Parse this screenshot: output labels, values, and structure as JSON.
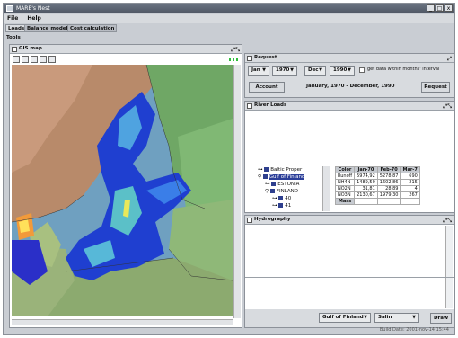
{
  "window": {
    "title": "MARE's Nest",
    "min": "_",
    "max": "□",
    "close": "x"
  },
  "menu": [
    "File",
    "Help"
  ],
  "tabs": [
    "Loads",
    "Balance model",
    "Cost calculation"
  ],
  "tools_label": "Tools",
  "gis": {
    "title": "GIS map"
  },
  "request": {
    "title": "Request",
    "from_month": "Jan",
    "from_year": "1970",
    "to_month": "Dec",
    "to_year": "1990",
    "checkbox_label": "get data within months' interval",
    "account_btn": "Account",
    "period": "January, 1970 - December, 1990",
    "request_btn": "Request"
  },
  "river_loads": {
    "title": "River Loads",
    "tree": [
      {
        "label": "Baltic Proper",
        "selected": false,
        "indent": 0
      },
      {
        "label": "Gulf of Finland",
        "selected": true,
        "indent": 0
      },
      {
        "label": "ESTONIA",
        "selected": false,
        "indent": 1
      },
      {
        "label": "FINLAND",
        "selected": false,
        "indent": 1
      },
      {
        "label": "40",
        "selected": false,
        "indent": 2
      },
      {
        "label": "41",
        "selected": false,
        "indent": 2
      }
    ],
    "columns": [
      "Color",
      "Jan-70",
      "Feb-70",
      "Mar-7"
    ],
    "rows": [
      [
        "Runoff",
        "5974,92",
        "5278,87",
        "690"
      ],
      [
        "NH4N",
        "1489,50",
        "1602,86",
        "215"
      ],
      [
        "NO2N",
        "31,81",
        "28,89",
        "4"
      ],
      [
        "NO3N",
        "2130,67",
        "1979,30",
        "267"
      ],
      [
        "Mass",
        "",
        "",
        ""
      ]
    ]
  },
  "hydrography": {
    "title": "Hydrography",
    "basin": "Gulf of Finland",
    "param": "Salin",
    "draw_btn": "Draw"
  },
  "status": "Build Date: 2001-nov-14 15:44"
}
